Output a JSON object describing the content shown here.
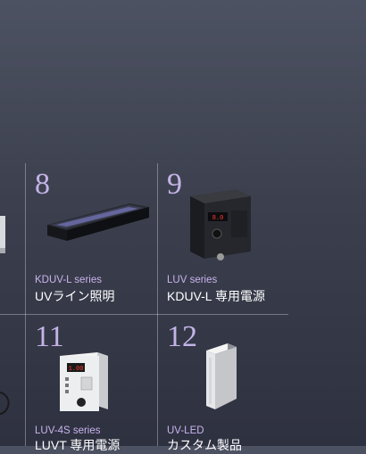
{
  "products": [
    {
      "number": "8",
      "series": "KDUV-L series",
      "name": "UVライン照明"
    },
    {
      "number": "9",
      "series": "LUV series",
      "name": "KDUV-L 専用電源"
    },
    {
      "number": "11",
      "series": "LUV-4S series",
      "name": "LUVT 専用電源"
    },
    {
      "number": "12",
      "series": "UV-LED",
      "name": "カスタム製品"
    }
  ],
  "devices": {
    "luv_display": "8.0",
    "luv4s_display": "1.00"
  },
  "colors": {
    "accent_number": "#c4b4e6",
    "accent_series": "#c9b4ee"
  }
}
